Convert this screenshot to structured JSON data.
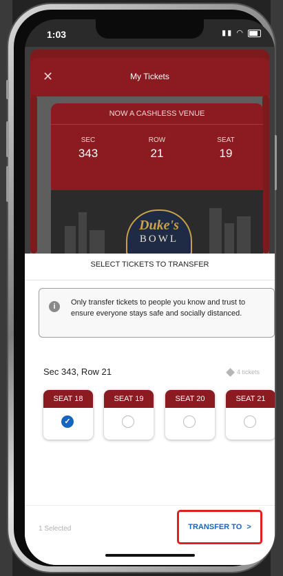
{
  "status_bar": {
    "time": "1:03"
  },
  "header": {
    "title": "My Tickets",
    "close_icon": "close-icon"
  },
  "ticket": {
    "venue_note": "NOW A CASHLESS VENUE",
    "fields": [
      {
        "label": "SEC",
        "value": "343"
      },
      {
        "label": "ROW",
        "value": "21"
      },
      {
        "label": "SEAT",
        "value": "19"
      }
    ],
    "logo": {
      "top": "Duke's",
      "bottom": "BOWL"
    }
  },
  "panel": {
    "title": "SELECT TICKETS TO TRANSFER",
    "notice": "Only transfer tickets to people you know and trust to ensure everyone stays safe and socially distanced.",
    "section": "Sec 343, Row 21",
    "ticket_count": "4 tickets",
    "seats": [
      {
        "label": "SEAT 18",
        "selected": true
      },
      {
        "label": "SEAT 19",
        "selected": false
      },
      {
        "label": "SEAT 20",
        "selected": false
      },
      {
        "label": "SEAT 21",
        "selected": false
      }
    ]
  },
  "footer": {
    "selected_text": "1 Selected",
    "transfer_label": "TRANSFER TO",
    "transfer_chevron": ">"
  },
  "colors": {
    "brand_red": "#8b1b20",
    "accent_blue": "#1565c0",
    "highlight_red": "#e02020"
  }
}
